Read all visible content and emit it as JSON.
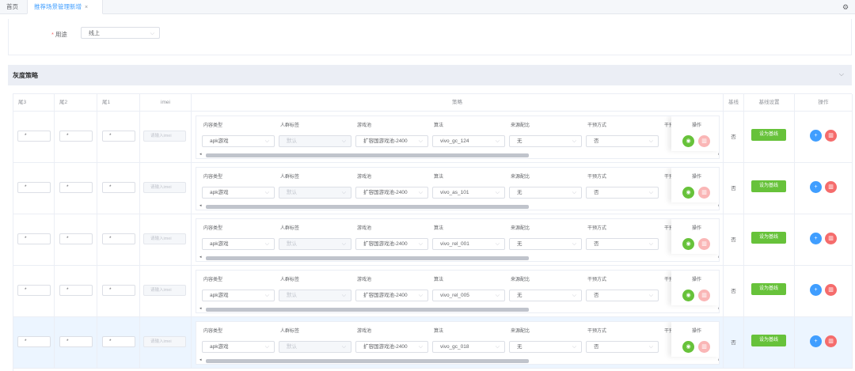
{
  "tabs": {
    "home": "首页",
    "active": "推荐场景管理新增",
    "close": "×"
  },
  "form": {
    "usage_label": "用途",
    "required_mark": "*",
    "usage_value": "线上"
  },
  "gray_section": {
    "title": "灰度策略"
  },
  "table": {
    "headers": {
      "tail3": "尾3",
      "tail2": "尾2",
      "tail1": "尾1",
      "imei": "imei",
      "strategy": "策略",
      "baseline": "基线",
      "baseline_settings": "基线设置",
      "ops": "操作"
    },
    "inner_headers": {
      "content_type": "内容类型",
      "crowd_tag": "人群标签",
      "game_pool": "游戏池",
      "algorithm": "算法",
      "source_ratio": "来源配比",
      "intervention": "干预方式",
      "intervention_trunc": "干预",
      "op": "操作"
    },
    "imei_placeholder": "请输入imei",
    "set_base_label": "设为基线",
    "rows": [
      {
        "tail3": "*",
        "tail2": "*",
        "tail1": "*",
        "content_type": "apk游戏",
        "crowd_tag": "默认",
        "game_pool": "扩容国游戏池-2400",
        "algorithm": "vivo_gc_124",
        "source_ratio": "无",
        "intervention": "否",
        "baseline": "否",
        "highlight": false
      },
      {
        "tail3": "*",
        "tail2": "*",
        "tail1": "*",
        "content_type": "apk游戏",
        "crowd_tag": "默认",
        "game_pool": "扩容国游戏池-2400",
        "algorithm": "vivo_as_101",
        "source_ratio": "无",
        "intervention": "否",
        "baseline": "否",
        "highlight": false
      },
      {
        "tail3": "*",
        "tail2": "*",
        "tail1": "*",
        "content_type": "apk游戏",
        "crowd_tag": "默认",
        "game_pool": "扩容国游戏池-2400",
        "algorithm": "vivo_rel_001",
        "source_ratio": "无",
        "intervention": "否",
        "baseline": "否",
        "highlight": false
      },
      {
        "tail3": "*",
        "tail2": "*",
        "tail1": "*",
        "content_type": "apk游戏",
        "crowd_tag": "默认",
        "game_pool": "扩容国游戏池-2400",
        "algorithm": "vivo_rel_005",
        "source_ratio": "无",
        "intervention": "否",
        "baseline": "否",
        "highlight": false
      },
      {
        "tail3": "*",
        "tail2": "*",
        "tail1": "*",
        "content_type": "apk游戏",
        "crowd_tag": "默认",
        "game_pool": "扩容国游戏池-2400",
        "algorithm": "vivo_gc_018",
        "source_ratio": "无",
        "intervention": "否",
        "baseline": "否",
        "highlight": true
      }
    ]
  },
  "icons": {
    "gear": "gear-icon",
    "chevron": "chevron-down-icon",
    "eye": "eye-icon",
    "delete": "trash-icon",
    "add": "plus-icon"
  },
  "colors": {
    "accent": "#409eff",
    "success": "#67c23a",
    "danger": "#f56c6c",
    "row_highlight": "#ecf5ff"
  }
}
